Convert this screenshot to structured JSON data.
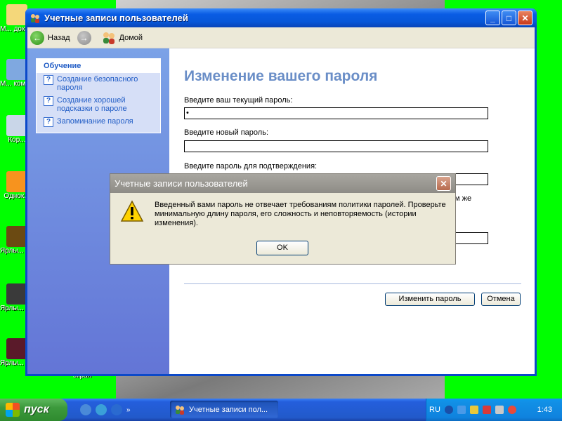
{
  "desktop": {
    "icons": [
      {
        "label": "М... доку...",
        "name": "my-documents"
      },
      {
        "label": "М... комп...",
        "name": "my-computer"
      },
      {
        "label": "Кор...",
        "name": "recycle-bin"
      },
      {
        "label": "Однок...",
        "name": "odnoklassniki"
      },
      {
        "label": "Ярлы... du...",
        "name": "shortcut-du"
      },
      {
        "label": "Ярлы... game...",
        "name": "shortcut-game"
      },
      {
        "label": "Ярлы... Lucky",
        "name": "shortcut-lucky"
      }
    ],
    "extra_label": "экран"
  },
  "window": {
    "title": "Учетные записи пользователей",
    "back_label": "Назад",
    "home_label": "Домой"
  },
  "sidebar": {
    "heading": "Обучение",
    "items": [
      {
        "label": "Создание безопасного пароля"
      },
      {
        "label": "Создание хорошей подсказки о пароле"
      },
      {
        "label": "Запоминание пароля"
      }
    ]
  },
  "content": {
    "title": "Изменение вашего пароля",
    "current_label": "Введите ваш текущий пароль:",
    "current_value": "•",
    "new_label": "Введите новый пароль:",
    "new_value": "",
    "confirm_label": "Введите пароль для подтверждения:",
    "hidden_fragment": "м же",
    "change_button": "Изменить пароль",
    "cancel_button": "Отмена"
  },
  "dialog": {
    "title": "Учетные записи пользователей",
    "message": "Введенный вами пароль не отвечает требованиям политики паролей. Проверьте минимальную длину пароля, его сложность и неповторяемость (истории изменения).",
    "ok_label": "OK"
  },
  "taskbar": {
    "start_label": "пуск",
    "task_label": "Учетные записи пол...",
    "lang": "RU",
    "clock": "1:43"
  },
  "colors": {
    "desktop": "#00ff00",
    "title_bar": "#0a5ce4",
    "sidebar": "#6c8fdd",
    "heading": "#6a8ec7"
  }
}
